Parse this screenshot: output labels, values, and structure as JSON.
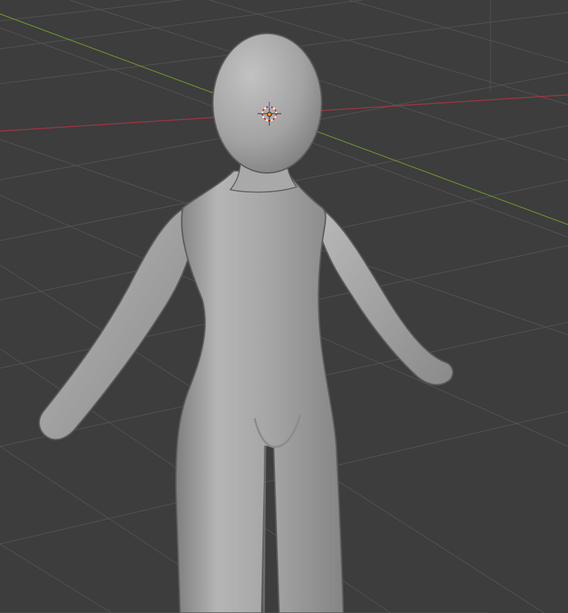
{
  "viewport": {
    "background": "#3d3d3d",
    "grid_color": "#545454",
    "x_axis_color": "#b3353f",
    "y_axis_color": "#6f9a2c"
  },
  "mesh": {
    "object": "humanoid-mesh",
    "shading": "solid",
    "base_color": "#a8a8a8"
  },
  "cursor": {
    "icon": "3d-cursor-icon"
  },
  "origin": {
    "color": "#f29a1c"
  }
}
